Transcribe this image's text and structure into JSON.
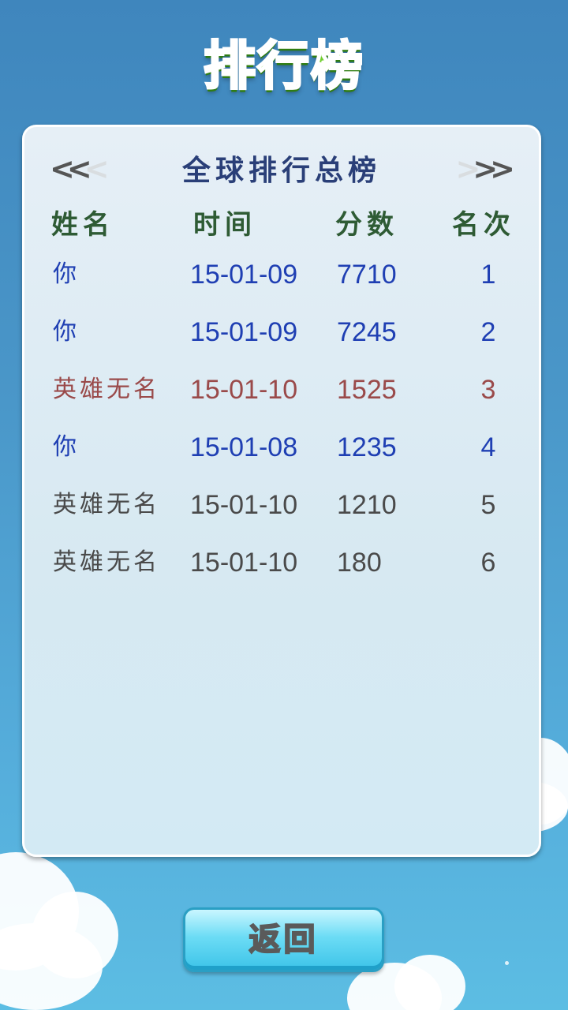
{
  "page": {
    "title": "排行榜"
  },
  "board": {
    "title": "全球排行总榜",
    "prev_arrow": "<<<",
    "next_arrow": ">>>"
  },
  "columns": {
    "name": "姓名",
    "time": "时间",
    "score": "分数",
    "rank": "名次"
  },
  "rows": [
    {
      "name": "你",
      "time": "15-01-09",
      "score": "7710",
      "rank": "1",
      "style": "you"
    },
    {
      "name": "你",
      "time": "15-01-09",
      "score": "7245",
      "rank": "2",
      "style": "you"
    },
    {
      "name": "英雄无名",
      "time": "15-01-10",
      "score": "1525",
      "rank": "3",
      "style": "highlight"
    },
    {
      "name": "你",
      "time": "15-01-08",
      "score": "1235",
      "rank": "4",
      "style": "you"
    },
    {
      "name": "英雄无名",
      "time": "15-01-10",
      "score": "1210",
      "rank": "5",
      "style": "other"
    },
    {
      "name": "英雄无名",
      "time": "15-01-10",
      "score": "180",
      "rank": "6",
      "style": "other"
    }
  ],
  "back_button": {
    "label": "返回"
  },
  "colors": {
    "you": "#1f3fb3",
    "highlight": "#9a4a4a",
    "other": "#4a4a4a",
    "header": "#2e5b34",
    "board_title": "#2a3f78"
  }
}
